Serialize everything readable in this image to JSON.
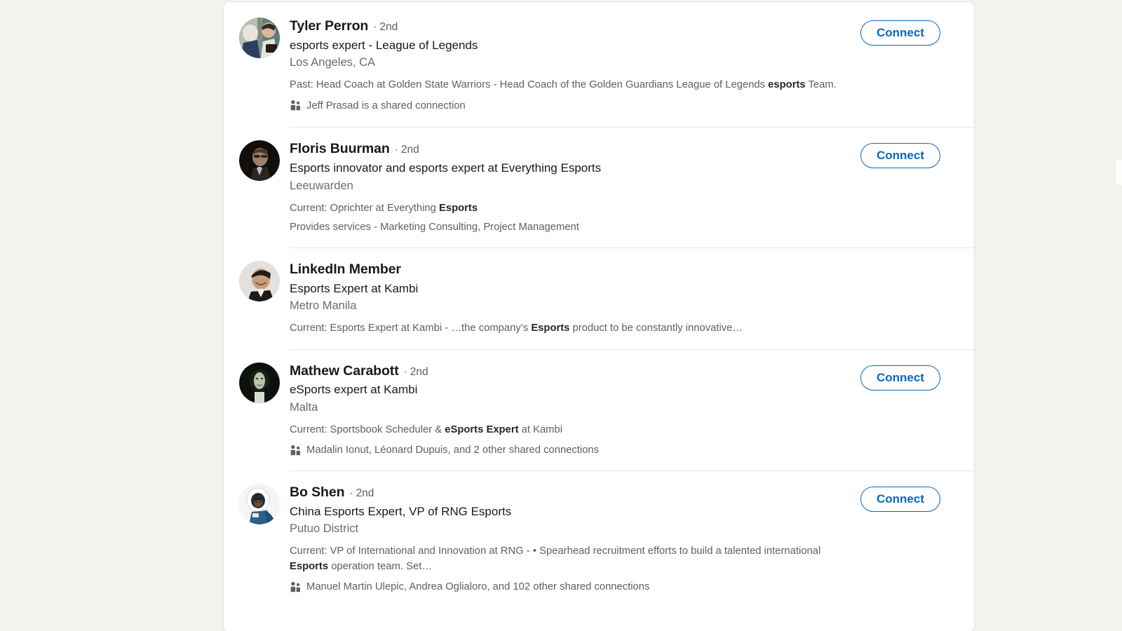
{
  "theme": {
    "page_background": "#f4f2ee",
    "card_background": "#ffffff",
    "accent_blue": "#0a66c2",
    "primary_text": "#191919",
    "secondary_text": "#6b6b6b",
    "snippet_text": "#5f5f5f",
    "divider": "#e8e6e3"
  },
  "results": [
    {
      "name": "Tyler Perron",
      "degree": "2nd",
      "separator": "·",
      "headline": "esports expert - League of Legends",
      "location": "Los Angeles, CA",
      "snippet_prefix": "Past: Head Coach at Golden State Warriors - Head Coach of the Golden Guardians League of Legends ",
      "snippet_highlight": "esports",
      "snippet_suffix": " Team.",
      "services": "",
      "shared": "Jeff Prasad is a shared connection",
      "shared_icon": "people-icon",
      "action_label": "Connect",
      "has_action": true,
      "avatar_icon": "avatar-photo-tyler-perron"
    },
    {
      "name": "Floris Buurman",
      "degree": "2nd",
      "separator": "·",
      "headline": "Esports innovator and esports expert at Everything Esports",
      "location": "Leeuwarden",
      "snippet_prefix": "Current: Oprichter at Everything ",
      "snippet_highlight": "Esports",
      "snippet_suffix": "",
      "services": "Provides services - Marketing Consulting, Project Management",
      "shared": "",
      "shared_icon": "",
      "action_label": "Connect",
      "has_action": true,
      "avatar_icon": "avatar-photo-floris-buurman"
    },
    {
      "name": "LinkedIn Member",
      "degree": "",
      "separator": "",
      "headline": "Esports Expert at Kambi",
      "location": "Metro Manila",
      "snippet_prefix": "Current: Esports Expert at Kambi - …the company’s ",
      "snippet_highlight": "Esports",
      "snippet_suffix": " product to be constantly innovative…",
      "services": "",
      "shared": "",
      "shared_icon": "",
      "action_label": "",
      "has_action": false,
      "avatar_icon": "avatar-photo-linkedin-member"
    },
    {
      "name": "Mathew Carabott",
      "degree": "2nd",
      "separator": "·",
      "headline": "eSports expert at Kambi",
      "location": "Malta",
      "snippet_prefix": "Current: Sportsbook Scheduler & ",
      "snippet_highlight": "eSports Expert",
      "snippet_suffix": " at Kambi",
      "services": "",
      "shared": "Madalin Ionut, Léonard Dupuis, and 2 other shared connections",
      "shared_icon": "people-icon",
      "action_label": "Connect",
      "has_action": true,
      "avatar_icon": "avatar-photo-mathew-carabott"
    },
    {
      "name": "Bo Shen",
      "degree": "2nd",
      "separator": "·",
      "headline": "China Esports Expert, VP of RNG Esports",
      "location": "Putuo District",
      "snippet_prefix": "Current: VP of International and Innovation at RNG - • Spearhead recruitment efforts to build a talented international ",
      "snippet_highlight": "Esports",
      "snippet_suffix": " operation team. Set…",
      "services": "",
      "shared": "Manuel Martin Ulepic, Andrea Oglialoro, and 102 other shared connections",
      "shared_icon": "people-icon",
      "action_label": "Connect",
      "has_action": true,
      "avatar_icon": "avatar-photo-bo-shen"
    }
  ]
}
